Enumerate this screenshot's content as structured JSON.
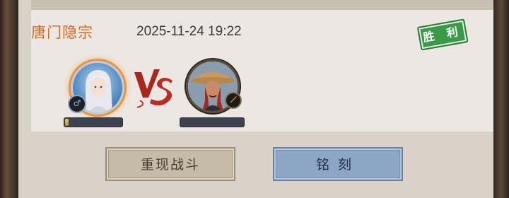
{
  "record": {
    "sect_name": "唐门隐宗",
    "datetime": "2025-11-24 19:22",
    "result": "胜 利",
    "vs_label": "VS"
  },
  "players": {
    "left": {
      "gender_symbol": "♂",
      "bar_fill_percent": 6
    },
    "right": {
      "bar_fill_percent": 0
    }
  },
  "buttons": {
    "replay_label": "重现战斗",
    "engrave_label": "铭刻"
  },
  "colors": {
    "sect_text": "#d46a22",
    "victory_stamp": "#3a9a48",
    "replay_button": "#c5bba8",
    "engrave_button": "#8ea6c6"
  }
}
